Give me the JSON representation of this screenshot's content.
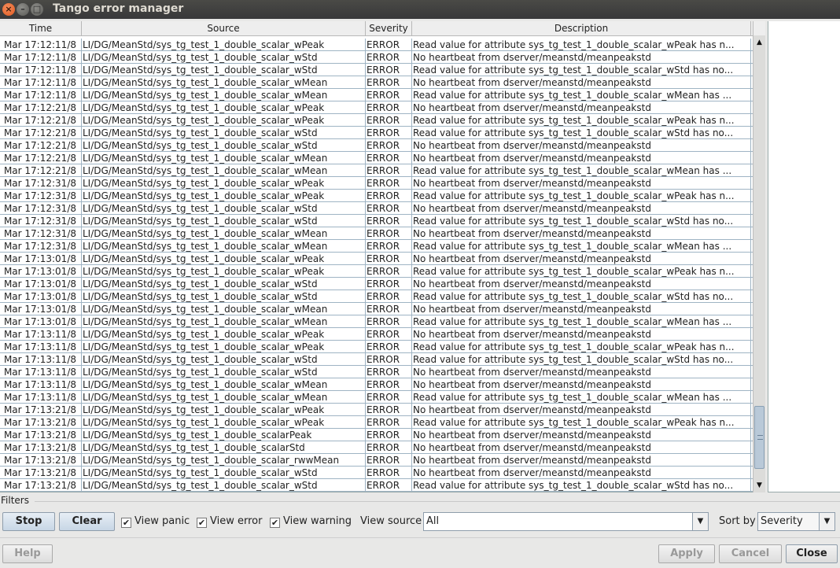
{
  "window": {
    "title": "Tango error manager"
  },
  "table": {
    "columns": {
      "time": "Time",
      "source": "Source",
      "severity": "Severity",
      "description": "Description"
    },
    "rows": [
      [
        "8/Mar 17:12:11",
        "LI/DG/MeanStd/sys_tg_test_1_double_scalar_wPeak",
        "ERROR",
        "Read value for attribute sys_tg_test_1_double_scalar_wPeak has n..."
      ],
      [
        "8/Mar 17:12:11",
        "LI/DG/MeanStd/sys_tg_test_1_double_scalar_wStd",
        "ERROR",
        "No heartbeat from dserver/meanstd/meanpeakstd"
      ],
      [
        "8/Mar 17:12:11",
        "LI/DG/MeanStd/sys_tg_test_1_double_scalar_wStd",
        "ERROR",
        "Read value for attribute sys_tg_test_1_double_scalar_wStd has no..."
      ],
      [
        "8/Mar 17:12:11",
        "LI/DG/MeanStd/sys_tg_test_1_double_scalar_wMean",
        "ERROR",
        "No heartbeat from dserver/meanstd/meanpeakstd"
      ],
      [
        "8/Mar 17:12:11",
        "LI/DG/MeanStd/sys_tg_test_1_double_scalar_wMean",
        "ERROR",
        "Read value for attribute sys_tg_test_1_double_scalar_wMean has ..."
      ],
      [
        "8/Mar 17:12:21",
        "LI/DG/MeanStd/sys_tg_test_1_double_scalar_wPeak",
        "ERROR",
        "No heartbeat from dserver/meanstd/meanpeakstd"
      ],
      [
        "8/Mar 17:12:21",
        "LI/DG/MeanStd/sys_tg_test_1_double_scalar_wPeak",
        "ERROR",
        "Read value for attribute sys_tg_test_1_double_scalar_wPeak has n..."
      ],
      [
        "8/Mar 17:12:21",
        "LI/DG/MeanStd/sys_tg_test_1_double_scalar_wStd",
        "ERROR",
        "Read value for attribute sys_tg_test_1_double_scalar_wStd has no..."
      ],
      [
        "8/Mar 17:12:21",
        "LI/DG/MeanStd/sys_tg_test_1_double_scalar_wStd",
        "ERROR",
        "No heartbeat from dserver/meanstd/meanpeakstd"
      ],
      [
        "8/Mar 17:12:21",
        "LI/DG/MeanStd/sys_tg_test_1_double_scalar_wMean",
        "ERROR",
        "No heartbeat from dserver/meanstd/meanpeakstd"
      ],
      [
        "8/Mar 17:12:21",
        "LI/DG/MeanStd/sys_tg_test_1_double_scalar_wMean",
        "ERROR",
        "Read value for attribute sys_tg_test_1_double_scalar_wMean has ..."
      ],
      [
        "8/Mar 17:12:31",
        "LI/DG/MeanStd/sys_tg_test_1_double_scalar_wPeak",
        "ERROR",
        "No heartbeat from dserver/meanstd/meanpeakstd"
      ],
      [
        "8/Mar 17:12:31",
        "LI/DG/MeanStd/sys_tg_test_1_double_scalar_wPeak",
        "ERROR",
        "Read value for attribute sys_tg_test_1_double_scalar_wPeak has n..."
      ],
      [
        "8/Mar 17:12:31",
        "LI/DG/MeanStd/sys_tg_test_1_double_scalar_wStd",
        "ERROR",
        "No heartbeat from dserver/meanstd/meanpeakstd"
      ],
      [
        "8/Mar 17:12:31",
        "LI/DG/MeanStd/sys_tg_test_1_double_scalar_wStd",
        "ERROR",
        "Read value for attribute sys_tg_test_1_double_scalar_wStd has no..."
      ],
      [
        "8/Mar 17:12:31",
        "LI/DG/MeanStd/sys_tg_test_1_double_scalar_wMean",
        "ERROR",
        "No heartbeat from dserver/meanstd/meanpeakstd"
      ],
      [
        "8/Mar 17:12:31",
        "LI/DG/MeanStd/sys_tg_test_1_double_scalar_wMean",
        "ERROR",
        "Read value for attribute sys_tg_test_1_double_scalar_wMean has ..."
      ],
      [
        "8/Mar 17:13:01",
        "LI/DG/MeanStd/sys_tg_test_1_double_scalar_wPeak",
        "ERROR",
        "No heartbeat from dserver/meanstd/meanpeakstd"
      ],
      [
        "8/Mar 17:13:01",
        "LI/DG/MeanStd/sys_tg_test_1_double_scalar_wPeak",
        "ERROR",
        "Read value for attribute sys_tg_test_1_double_scalar_wPeak has n..."
      ],
      [
        "8/Mar 17:13:01",
        "LI/DG/MeanStd/sys_tg_test_1_double_scalar_wStd",
        "ERROR",
        "No heartbeat from dserver/meanstd/meanpeakstd"
      ],
      [
        "8/Mar 17:13:01",
        "LI/DG/MeanStd/sys_tg_test_1_double_scalar_wStd",
        "ERROR",
        "Read value for attribute sys_tg_test_1_double_scalar_wStd has no..."
      ],
      [
        "8/Mar 17:13:01",
        "LI/DG/MeanStd/sys_tg_test_1_double_scalar_wMean",
        "ERROR",
        "No heartbeat from dserver/meanstd/meanpeakstd"
      ],
      [
        "8/Mar 17:13:01",
        "LI/DG/MeanStd/sys_tg_test_1_double_scalar_wMean",
        "ERROR",
        "Read value for attribute sys_tg_test_1_double_scalar_wMean has ..."
      ],
      [
        "8/Mar 17:13:11",
        "LI/DG/MeanStd/sys_tg_test_1_double_scalar_wPeak",
        "ERROR",
        "No heartbeat from dserver/meanstd/meanpeakstd"
      ],
      [
        "8/Mar 17:13:11",
        "LI/DG/MeanStd/sys_tg_test_1_double_scalar_wPeak",
        "ERROR",
        "Read value for attribute sys_tg_test_1_double_scalar_wPeak has n..."
      ],
      [
        "8/Mar 17:13:11",
        "LI/DG/MeanStd/sys_tg_test_1_double_scalar_wStd",
        "ERROR",
        "Read value for attribute sys_tg_test_1_double_scalar_wStd has no..."
      ],
      [
        "8/Mar 17:13:11",
        "LI/DG/MeanStd/sys_tg_test_1_double_scalar_wStd",
        "ERROR",
        "No heartbeat from dserver/meanstd/meanpeakstd"
      ],
      [
        "8/Mar 17:13:11",
        "LI/DG/MeanStd/sys_tg_test_1_double_scalar_wMean",
        "ERROR",
        "No heartbeat from dserver/meanstd/meanpeakstd"
      ],
      [
        "8/Mar 17:13:11",
        "LI/DG/MeanStd/sys_tg_test_1_double_scalar_wMean",
        "ERROR",
        "Read value for attribute sys_tg_test_1_double_scalar_wMean has ..."
      ],
      [
        "8/Mar 17:13:21",
        "LI/DG/MeanStd/sys_tg_test_1_double_scalar_wPeak",
        "ERROR",
        "No heartbeat from dserver/meanstd/meanpeakstd"
      ],
      [
        "8/Mar 17:13:21",
        "LI/DG/MeanStd/sys_tg_test_1_double_scalar_wPeak",
        "ERROR",
        "Read value for attribute sys_tg_test_1_double_scalar_wPeak has n..."
      ],
      [
        "8/Mar 17:13:21",
        "LI/DG/MeanStd/sys_tg_test_1_double_scalarPeak",
        "ERROR",
        "No heartbeat from dserver/meanstd/meanpeakstd"
      ],
      [
        "8/Mar 17:13:21",
        "LI/DG/MeanStd/sys_tg_test_1_double_scalarStd",
        "ERROR",
        "No heartbeat from dserver/meanstd/meanpeakstd"
      ],
      [
        "8/Mar 17:13:21",
        "LI/DG/MeanStd/sys_tg_test_1_double_scalar_rwwMean",
        "ERROR",
        "No heartbeat from dserver/meanstd/meanpeakstd"
      ],
      [
        "8/Mar 17:13:21",
        "LI/DG/MeanStd/sys_tg_test_1_double_scalar_wStd",
        "ERROR",
        "No heartbeat from dserver/meanstd/meanpeakstd"
      ],
      [
        "8/Mar 17:13:21",
        "LI/DG/MeanStd/sys_tg_test_1_double_scalar_wStd",
        "ERROR",
        "Read value for attribute sys_tg_test_1_double_scalar_wStd has no..."
      ]
    ]
  },
  "filters": {
    "label": "Filters",
    "stop_label": "Stop",
    "clear_label": "Clear",
    "view_panic": "View panic",
    "view_error": "View error",
    "view_warning": "View warning",
    "view_panic_checked": true,
    "view_error_checked": true,
    "view_warning_checked": true,
    "view_source_label": "View source",
    "view_source_value": "All",
    "sort_by_label": "Sort by",
    "sort_by_value": "Severity"
  },
  "footer": {
    "help_label": "Help",
    "apply_label": "Apply",
    "cancel_label": "Cancel",
    "close_label": "Close"
  },
  "colors": {
    "titlebar": "#3c3b37",
    "close_button": "#e05a20",
    "grid_line": "#9fb4c4",
    "button_face": "#c7d6e5"
  }
}
